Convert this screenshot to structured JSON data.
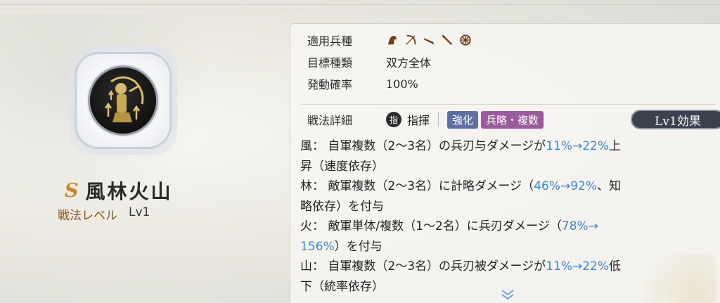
{
  "skill": {
    "rank": "S",
    "name": "風林火山",
    "level_label": "戦法レベル",
    "level_value": "Lv1"
  },
  "info": {
    "troop_label": "適用兵種",
    "troop_icons": [
      "cavalry-icon",
      "bow-icon",
      "gun-icon",
      "spear-icon",
      "siege-icon"
    ],
    "target_label": "目標種類",
    "target_value": "双方全体",
    "rate_label": "発動確率",
    "rate_value": "100%"
  },
  "detail": {
    "label": "戦法詳細",
    "cmd_icon_char": "指",
    "type": "指揮",
    "tags": [
      "強化",
      "兵略・複数"
    ],
    "effect_button": "Lv1効果"
  },
  "description": [
    [
      {
        "t": "風： 自軍複数（2〜3名）の兵刃与ダメージが"
      },
      {
        "t": "11%→22%",
        "hl": true
      },
      {
        "t": "上"
      }
    ],
    [
      {
        "t": "昇（速度依存）"
      }
    ],
    [
      {
        "t": "林： 敵軍複数（2〜3名）に計略ダメージ（"
      },
      {
        "t": "46%→92%",
        "hl": true
      },
      {
        "t": "、知"
      }
    ],
    [
      {
        "t": "略依存）を付与"
      }
    ],
    [
      {
        "t": "火： 敵軍単体/複数（1〜2名）に兵刃ダメージ（"
      },
      {
        "t": "78%→",
        "hl": true
      }
    ],
    [
      {
        "t": "156%",
        "hl": true
      },
      {
        "t": "）を付与"
      }
    ],
    [
      {
        "t": "山： 自軍複数（2〜3名）の兵刃被ダメージが"
      },
      {
        "t": "11%→22%",
        "hl": true
      },
      {
        "t": "低"
      }
    ],
    [
      {
        "t": "下（統率依存）"
      }
    ]
  ],
  "colors": {
    "highlight": "#3d86d8",
    "rank": "#c9872a",
    "tag_enhance": "#5e6fa3",
    "tag_strategy": "#9a5c9a"
  }
}
